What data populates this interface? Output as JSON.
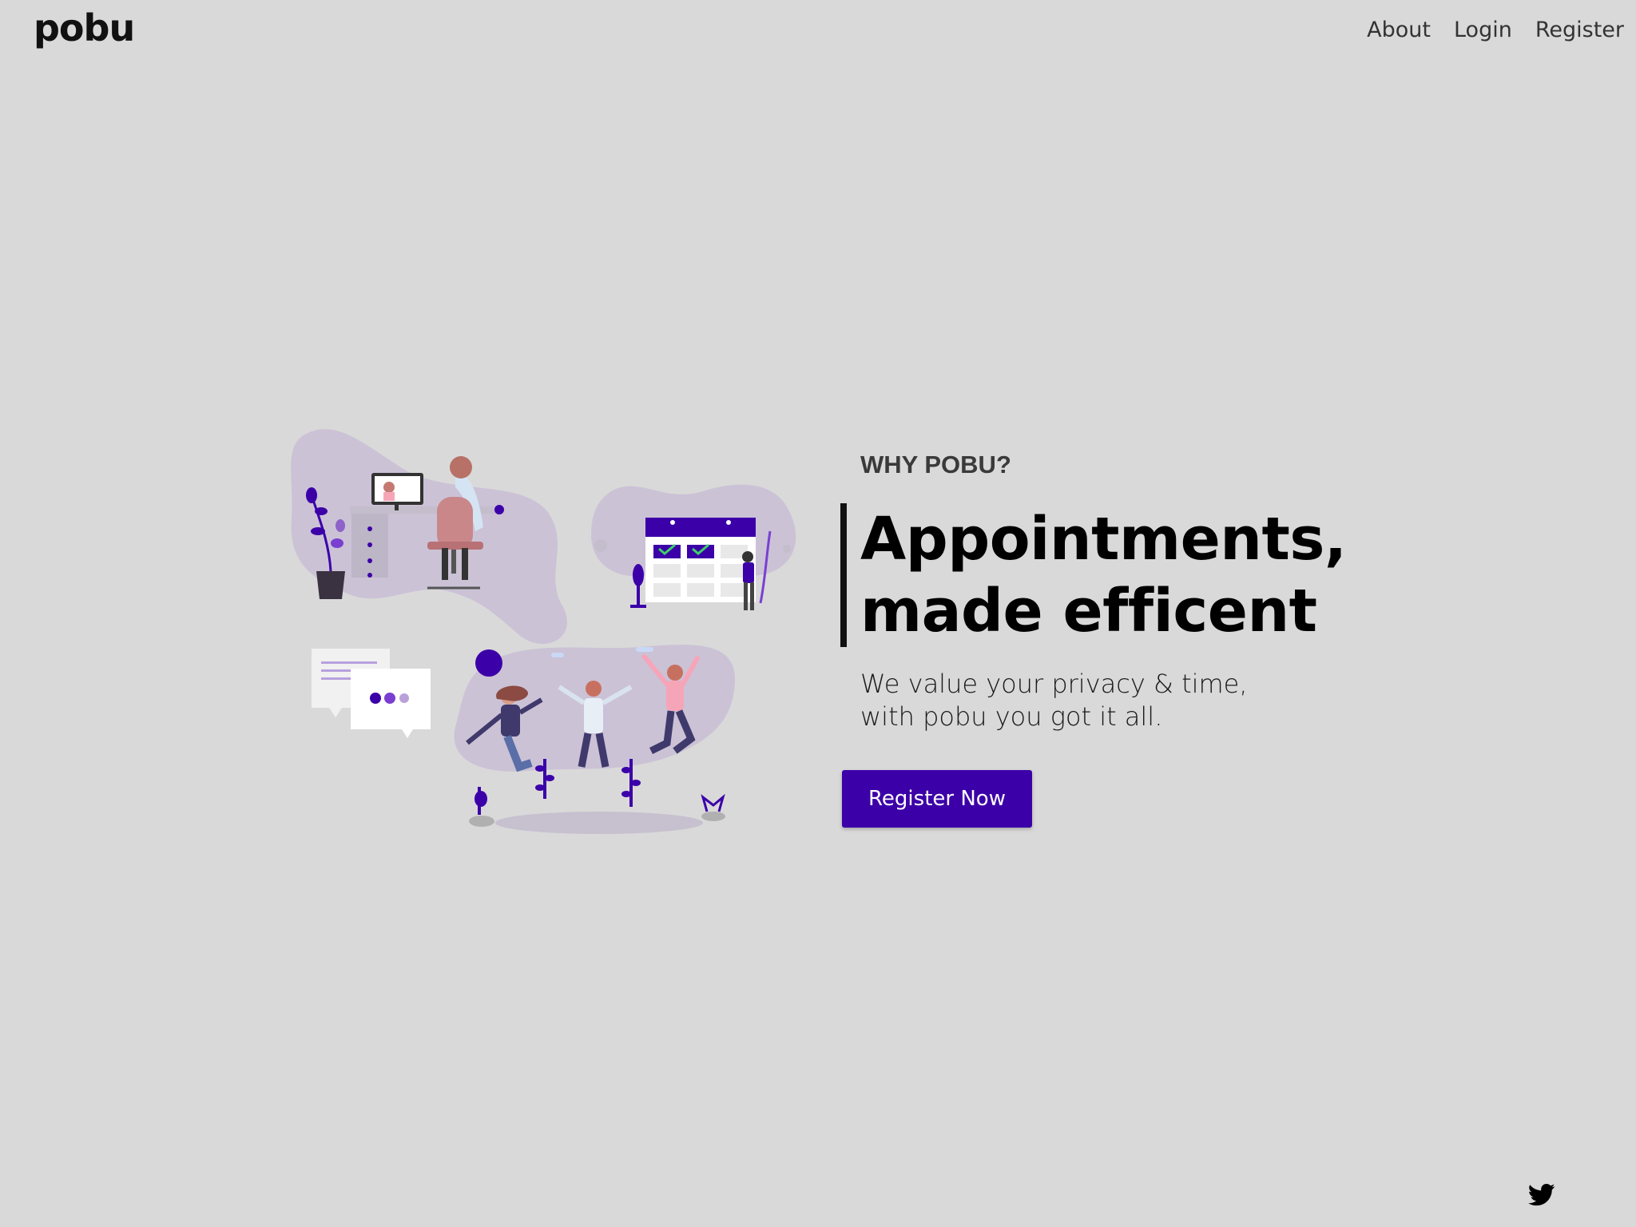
{
  "header": {
    "logo": "pobu",
    "nav": [
      {
        "label": "About"
      },
      {
        "label": "Login"
      },
      {
        "label": "Register"
      }
    ]
  },
  "hero": {
    "eyebrow": "WHY POBU?",
    "headline_line1": "Appointments,",
    "headline_line2": "made efficent",
    "sub_line1": "We value your privacy & time,",
    "sub_line2": "with pobu you got it all.",
    "cta_label": "Register Now"
  },
  "footer": {
    "social_icon": "twitter-icon"
  },
  "colors": {
    "background": "#d9d9d9",
    "accent": "#3c00a8",
    "text": "#000000"
  }
}
